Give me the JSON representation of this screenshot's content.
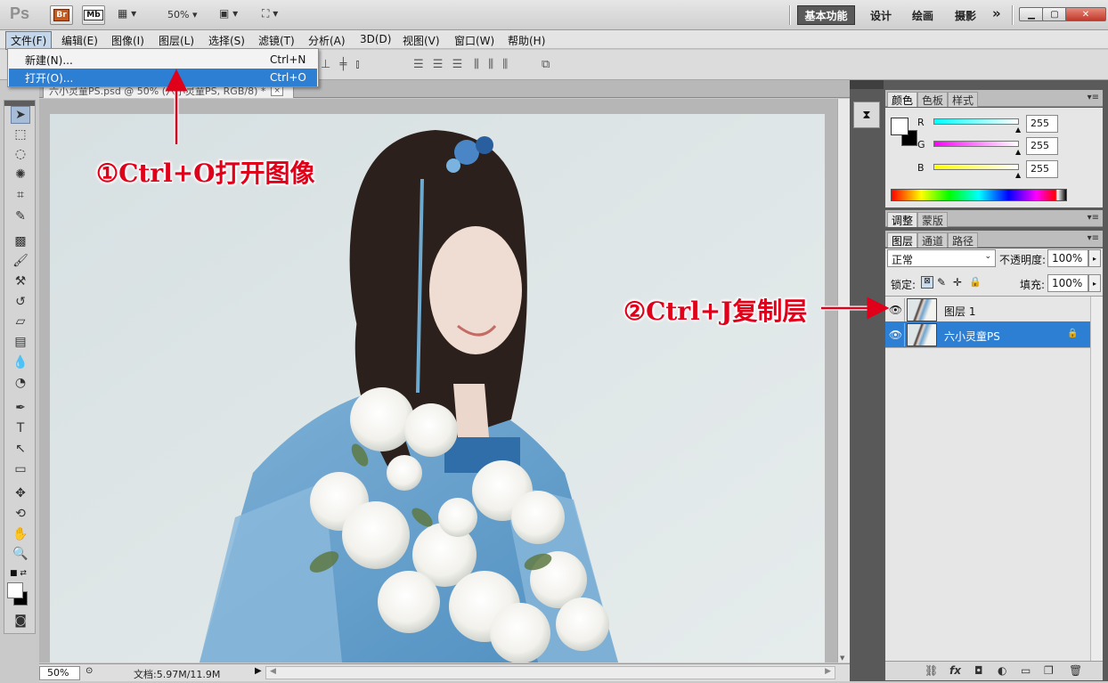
{
  "app": {
    "logo": "Ps",
    "bridge": "Br",
    "mini_bridge": "Mb",
    "zoom": "50%",
    "workspaces": {
      "active": "基本功能",
      "others": [
        "设计",
        "绘画",
        "摄影"
      ]
    },
    "more": "»"
  },
  "menu": [
    "文件(F)",
    "编辑(E)",
    "图像(I)",
    "图层(L)",
    "选择(S)",
    "滤镜(T)",
    "分析(A)",
    "3D(D)",
    "视图(V)",
    "窗口(W)",
    "帮助(H)"
  ],
  "file_menu": {
    "items": [
      {
        "label": "新建(N)...",
        "shortcut": "Ctrl+N",
        "selected": false
      },
      {
        "label": "打开(O)...",
        "shortcut": "Ctrl+O",
        "selected": true
      }
    ]
  },
  "document": {
    "tab_title": "六小灵童PS.psd @ 50% (六小灵童PS, RGB/8) *",
    "tab_close": "×",
    "zoom_field": "50%",
    "doc_info": "文档:5.97M/11.9M"
  },
  "panels": {
    "color": {
      "tabs": [
        "颜色",
        "色板",
        "样式"
      ],
      "channels": [
        {
          "label": "R",
          "value": "255"
        },
        {
          "label": "G",
          "value": "255"
        },
        {
          "label": "B",
          "value": "255"
        }
      ]
    },
    "adjust": {
      "tabs": [
        "调整",
        "蒙版"
      ]
    },
    "layers": {
      "tabs": [
        "图层",
        "通道",
        "路径"
      ],
      "blend_mode": "正常",
      "opacity_label": "不透明度:",
      "opacity": "100%",
      "lock_label": "锁定:",
      "fill_label": "填充:",
      "fill": "100%",
      "rows": [
        {
          "name": "图层 1",
          "selected": false,
          "locked": false
        },
        {
          "name": "六小灵童PS",
          "selected": true,
          "locked": true
        }
      ]
    }
  },
  "annotations": {
    "step1": "①Ctrl+O打开图像",
    "step2": "②Ctrl+J复制层"
  }
}
